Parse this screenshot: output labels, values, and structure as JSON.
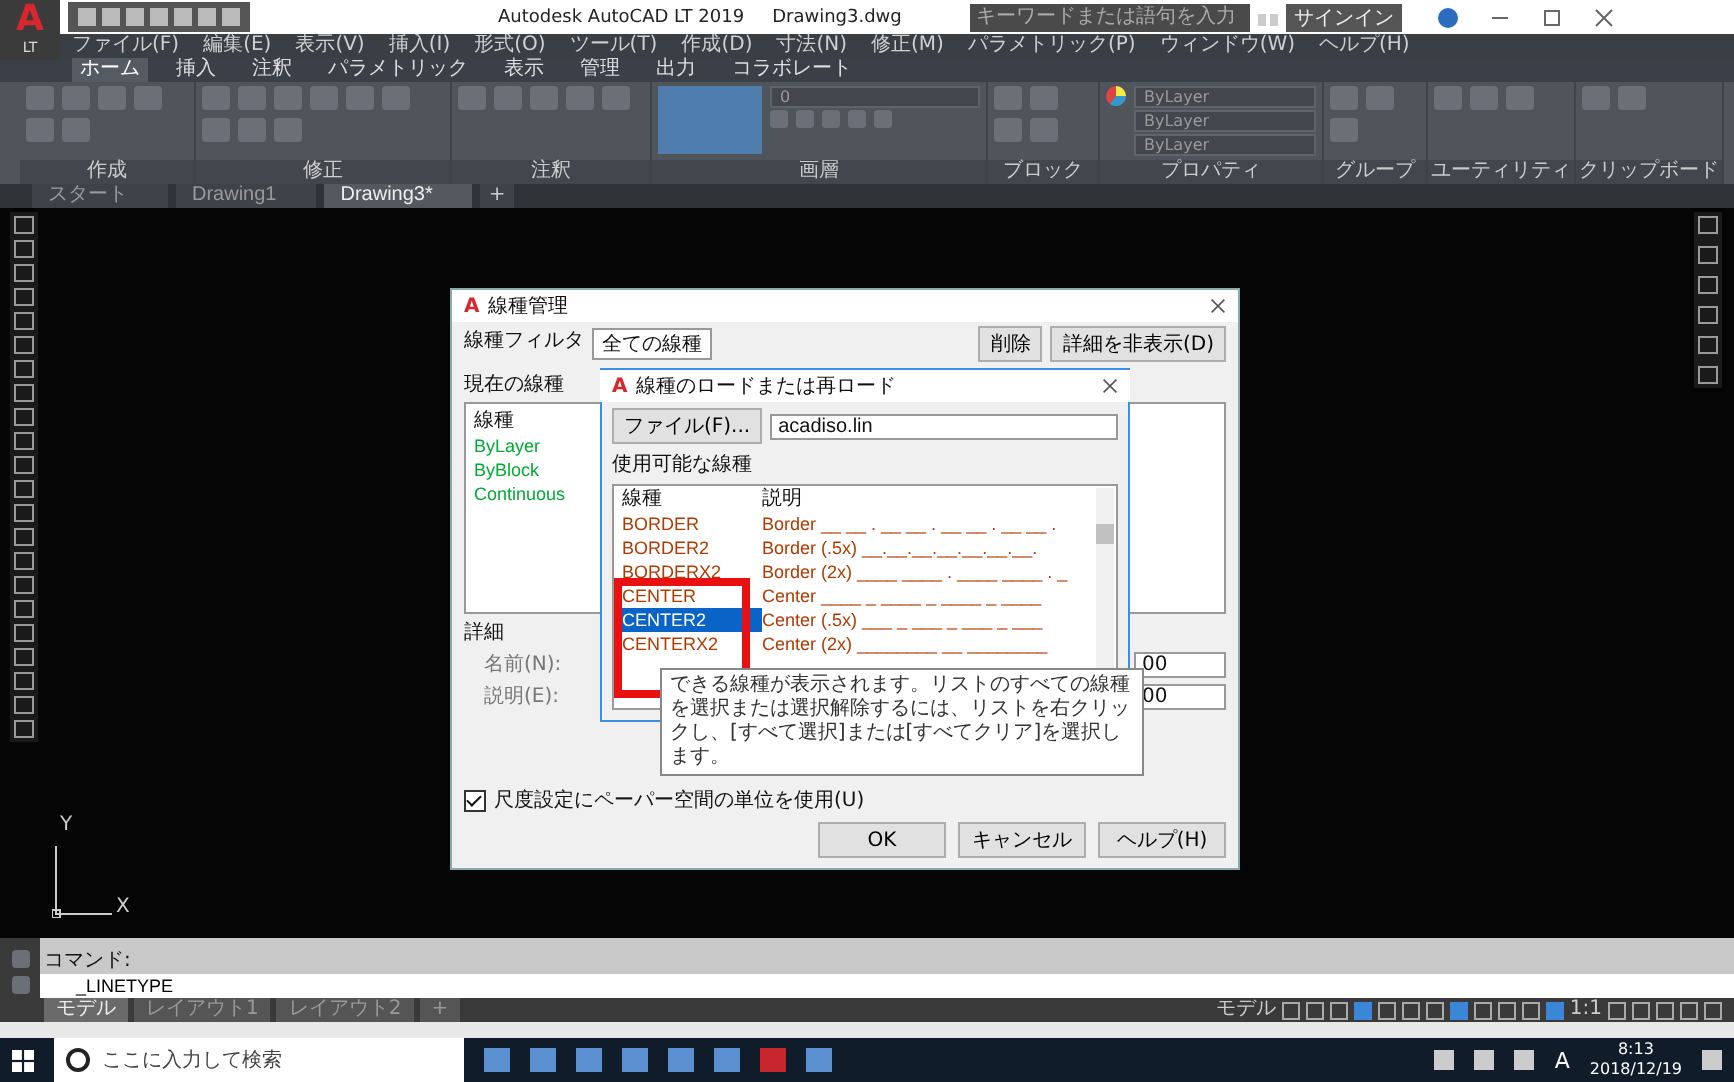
{
  "title_bar": {
    "logo": "A",
    "logo_sub": "LT",
    "title": "Autodesk AutoCAD LT 2019",
    "document": "Drawing3.dwg",
    "search": {
      "placeholder": "キーワードまたは語句を入力"
    },
    "sign_in": "サインイン"
  },
  "menu_bar": [
    "ファイル(F)",
    "編集(E)",
    "表示(V)",
    "挿入(I)",
    "形式(O)",
    "ツール(T)",
    "作成(D)",
    "寸法(N)",
    "修正(M)",
    "パラメトリック(P)",
    "ウィンドウ(W)",
    "ヘルプ(H)"
  ],
  "ribbon_tabs": [
    {
      "label": "ホーム",
      "selected": true
    },
    {
      "label": "挿入",
      "selected": false
    },
    {
      "label": "注釈",
      "selected": false
    },
    {
      "label": "パラメトリック",
      "selected": false
    },
    {
      "label": "表示",
      "selected": false
    },
    {
      "label": "管理",
      "selected": false
    },
    {
      "label": "出力",
      "selected": false
    },
    {
      "label": "コラボレート",
      "selected": false
    }
  ],
  "ribbon_panels": [
    {
      "label": "作成",
      "kind": "tools"
    },
    {
      "label": "修正",
      "kind": "tools"
    },
    {
      "label": "注釈",
      "kind": "tools"
    },
    {
      "label": "画層",
      "kind": "layer",
      "layer": "0"
    },
    {
      "label": "ブロック",
      "kind": "tools"
    },
    {
      "label": "プロパティ",
      "kind": "properties",
      "dropdowns": [
        "ByLayer",
        "ByLayer",
        "ByLayer"
      ]
    },
    {
      "label": "グループ",
      "kind": "tools"
    },
    {
      "label": "ユーティリティ",
      "kind": "tools"
    },
    {
      "label": "クリップボード",
      "kind": "tools"
    }
  ],
  "file_tabs": [
    {
      "label": "スタート",
      "selected": false
    },
    {
      "label": "Drawing1",
      "selected": false
    },
    {
      "label": "Drawing3*",
      "selected": true
    }
  ],
  "new_tab": "+",
  "ucs": {
    "y": "Y",
    "x": "X"
  },
  "linetype_manager": {
    "icon": "A",
    "title": "線種管理",
    "filter_label": "線種フィルタ",
    "filter_value": "全ての線種",
    "buttons": [
      "削除",
      "詳細を非表示(D)"
    ],
    "current_label": "現在の線種",
    "list_header": "線種",
    "items": [
      "ByLayer",
      "ByBlock",
      "Continuous"
    ],
    "details_label": "詳細",
    "name_label": "名前(N):",
    "desc_label": "説明(E):",
    "scale_values": [
      "00",
      "00"
    ],
    "paper_space": {
      "label": "尺度設定にペーパー空間の単位を使用(U)",
      "checked": true
    },
    "footer_buttons": [
      "OK",
      "キャンセル",
      "ヘルプ(H)"
    ]
  },
  "load_dialog": {
    "icon": "A",
    "title": "線種のロードまたは再ロード",
    "file_button": "ファイル(F)...",
    "file_value": "acadiso.lin",
    "list_label": "使用可能な線種",
    "columns": [
      "線種",
      "説明"
    ],
    "rows": [
      {
        "name": "BORDER",
        "description": "Border __ __ . __ __ . __ __ . __ __ .",
        "selected": false
      },
      {
        "name": "BORDER2",
        "description": "Border (.5x) __.__.__.__.__.__.__.",
        "selected": false
      },
      {
        "name": "BORDERX2",
        "description": "Border (2x) ____ ____ . ____ ____ . _",
        "selected": false
      },
      {
        "name": "CENTER",
        "description": "Center ____ _ ____ _ ____ _ ____",
        "selected": false
      },
      {
        "name": "CENTER2",
        "description": "Center (.5x) ___ _ ___ _ ___ _ ___",
        "selected": true
      },
      {
        "name": "CENTERX2",
        "description": "Center (2x) ________  __  ________",
        "selected": false
      }
    ],
    "tooltip": "できる線種が表示されます。リストのすべての線種を選択または選択解除するには、リストを右クリックし、[すべて選択]または[すべてクリア]を選択します。"
  },
  "command_line": {
    "label": "コマンド:",
    "value": "_LINETYPE"
  },
  "layout_tabs": [
    {
      "label": "モデル",
      "selected": true
    },
    {
      "label": "レイアウト1",
      "selected": false
    },
    {
      "label": "レイアウト2",
      "selected": false
    }
  ],
  "new_layout": "+",
  "status_bar": {
    "model": "モデル",
    "scale": "1:1"
  },
  "taskbar": {
    "search_placeholder": "ここに入力して検索",
    "ime": "A",
    "time": "8:13",
    "date": "2018/12/19"
  }
}
